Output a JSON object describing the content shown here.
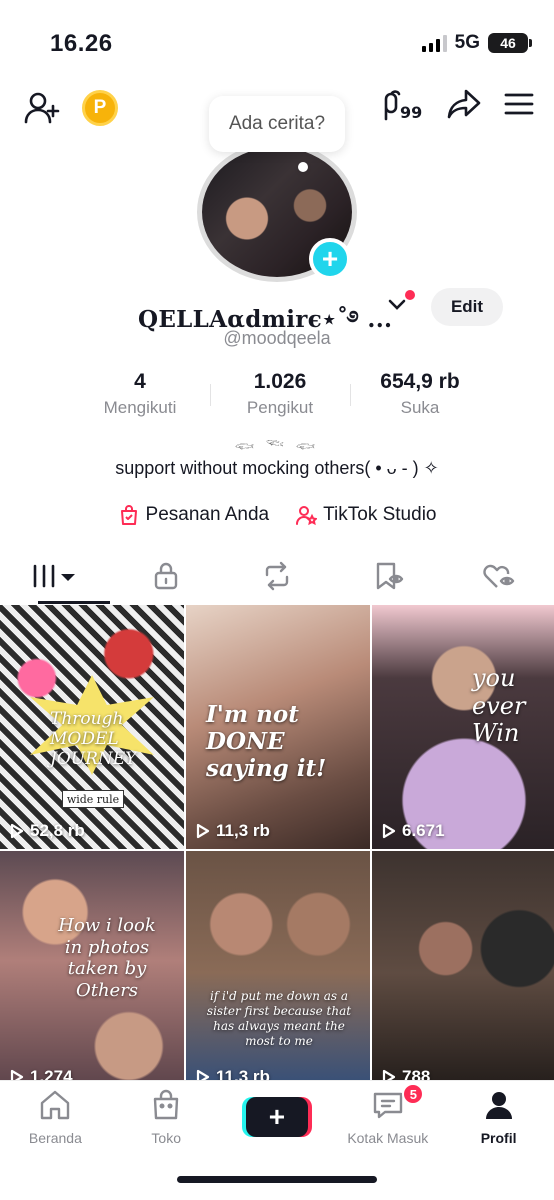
{
  "status_bar": {
    "time": "16.26",
    "network": "5G",
    "battery": "46"
  },
  "header": {
    "coin_label": "P",
    "mark_count": "99"
  },
  "profile": {
    "story_prompt": "Ada cerita?",
    "display_name": "QELLAαdmirє⋆˚࿔ ...",
    "username": "@moodqeela",
    "edit_label": "Edit",
    "fish": "𓆟 𓆝 𓆟",
    "bio": "support without mocking others( • ᴗ - ) ✧"
  },
  "stats": [
    {
      "value": "4",
      "label": "Mengikuti"
    },
    {
      "value": "1.026",
      "label": "Pengikut"
    },
    {
      "value": "654,9 rb",
      "label": "Suka"
    }
  ],
  "links": [
    {
      "label": "Pesanan Anda",
      "icon": "shopping-bag-icon"
    },
    {
      "label": "TikTok Studio",
      "icon": "creator-icon"
    }
  ],
  "tabs": [
    {
      "name": "videos",
      "icon": "grid-icon"
    },
    {
      "name": "private",
      "icon": "lock-icon"
    },
    {
      "name": "reposts",
      "icon": "repost-icon"
    },
    {
      "name": "favorites",
      "icon": "bookmark-icon"
    },
    {
      "name": "liked",
      "icon": "heart-icon"
    }
  ],
  "videos": [
    {
      "views": "52,8 rb",
      "overlay": "Through MODEL JOURNEY",
      "tag": "wide rule"
    },
    {
      "views": "11,3 rb",
      "overlay": "I'm not DONE saying it!"
    },
    {
      "views": "6.671",
      "overlay": "you ever Win"
    },
    {
      "views": "1.274",
      "overlay": "How i look in photos taken by Others"
    },
    {
      "views": "11,3 rb",
      "overlay": "if i'd put me down as a sister first because that has always meant the most to me"
    },
    {
      "views": "788",
      "overlay": ""
    }
  ],
  "nav": [
    {
      "label": "Beranda",
      "icon": "home-icon"
    },
    {
      "label": "Toko",
      "icon": "shop-icon"
    },
    {
      "label": "",
      "icon": "plus-icon"
    },
    {
      "label": "Kotak Masuk",
      "icon": "inbox-icon",
      "badge": "5"
    },
    {
      "label": "Profil",
      "icon": "profile-icon"
    }
  ],
  "colors": {
    "accent": "#fe2c55",
    "cyan": "#20d5ec",
    "coin": "#f7b30a"
  }
}
